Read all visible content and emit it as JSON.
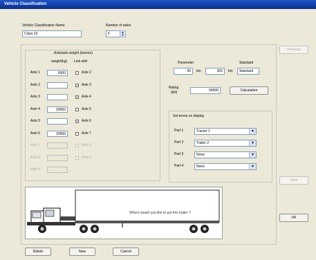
{
  "window": {
    "title": "Vehicle Classification"
  },
  "header": {
    "name_label": "Vehicle Classification Name",
    "name_value": "Class 10",
    "count_label": "Number of axles",
    "count_value": "6"
  },
  "weights": {
    "title": "Axle/axle weight (tonnes)",
    "col_weight": "weight(kg)",
    "col_link": "Link with",
    "rows": [
      {
        "label": "Axle 1",
        "value": "5000",
        "link": "Axle 2",
        "checked": false,
        "enabled": true
      },
      {
        "label": "Axle 2",
        "value": "",
        "link": "Axle 3",
        "checked": true,
        "enabled": true
      },
      {
        "label": "Axle 3",
        "value": "",
        "link": "Axle 4",
        "checked": true,
        "enabled": true
      },
      {
        "label": "Axle 4",
        "value": "20000",
        "link": "Axle 5",
        "checked": false,
        "enabled": true
      },
      {
        "label": "Axle 5",
        "value": "",
        "link": "Axle 6",
        "checked": true,
        "enabled": true
      },
      {
        "label": "Axle 6",
        "value": "20000",
        "link": "Axle 7",
        "checked": false,
        "enabled": true
      },
      {
        "label": "Axle 7",
        "value": "",
        "link": "Axle 8",
        "checked": false,
        "enabled": false
      },
      {
        "label": "Axle 8",
        "value": "",
        "link": "Axle 9",
        "checked": false,
        "enabled": false
      },
      {
        "label": "Axle 9",
        "value": "",
        "link": "",
        "checked": false,
        "enabled": false
      }
    ]
  },
  "params": {
    "p1_label": "Parameter",
    "p1_value": "50",
    "p1_unit": "km",
    "p2_value": "300",
    "p2_unit": "km",
    "p3_label": "Standard",
    "p3_value": "Standard",
    "rating_label": "Rating",
    "rating_sub": "(kN)",
    "rating_value": "54000",
    "calc_button": "Calculation"
  },
  "display": {
    "title": "Set terms on display",
    "rows": [
      {
        "label": "Part 1",
        "value": "Tractor 1"
      },
      {
        "label": "Part 2",
        "value": "Trailer 2"
      },
      {
        "label": "Part 3",
        "value": "None"
      },
      {
        "label": "Part 4",
        "value": "None"
      }
    ]
  },
  "preview": {
    "caption": "Where would you like to put this trailer ?"
  },
  "side_buttons": {
    "top": "Previous",
    "mid": "Next",
    "ok": "OK"
  },
  "bottom_buttons": {
    "delete": "Delete",
    "new": "New",
    "cancel": "Cancel"
  }
}
